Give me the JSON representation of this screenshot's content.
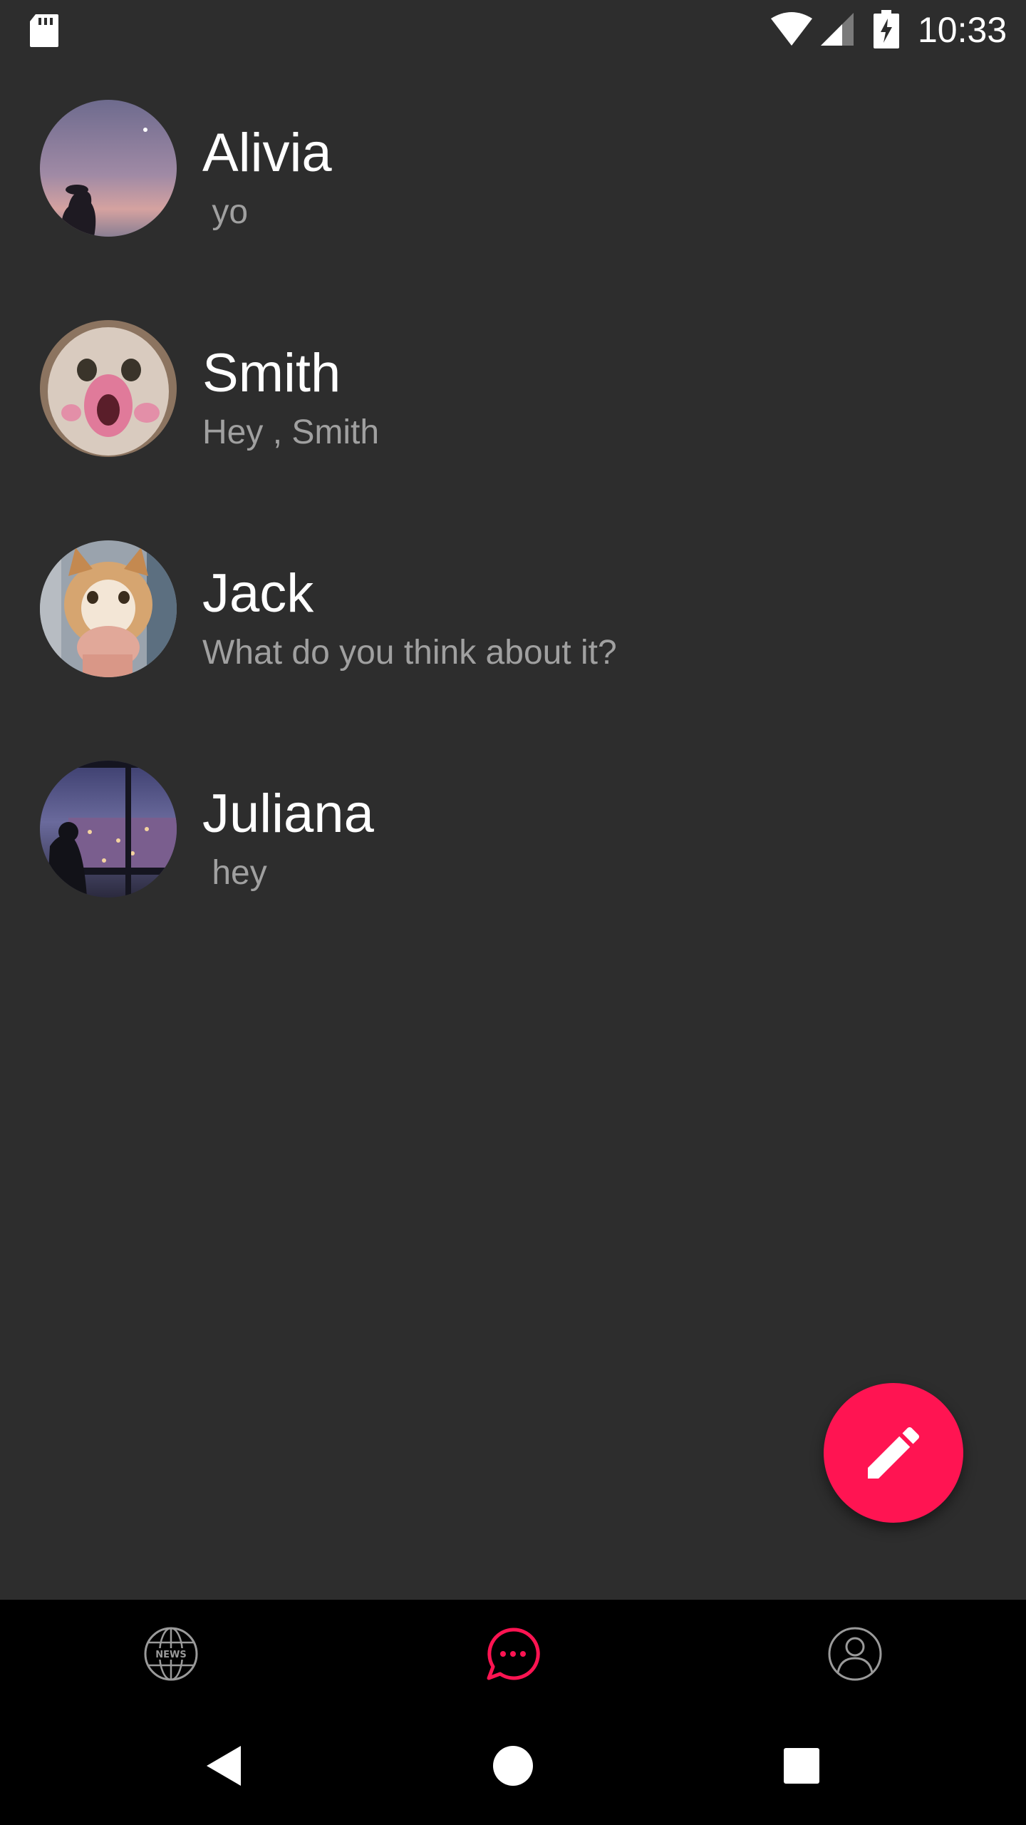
{
  "status_bar": {
    "time": "10:33",
    "icons": [
      "sd-card-icon",
      "wifi-icon",
      "cell-signal-icon",
      "battery-charging-icon"
    ]
  },
  "conversations": [
    {
      "name": "Alivia",
      "last_message": " yo",
      "avatar": "avatar-alivia"
    },
    {
      "name": "Smith",
      "last_message": "Hey , Smith",
      "avatar": "avatar-smith"
    },
    {
      "name": "Jack",
      "last_message": "What do you think about it?",
      "avatar": "avatar-jack"
    },
    {
      "name": "Juliana",
      "last_message": " hey",
      "avatar": "avatar-juliana"
    }
  ],
  "fab": {
    "icon": "pencil-icon"
  },
  "bottom_nav": {
    "tabs": [
      {
        "icon": "news-globe-icon",
        "label": "NEWS",
        "active": false
      },
      {
        "icon": "chat-bubble-icon",
        "active": true
      },
      {
        "icon": "profile-icon",
        "active": false
      }
    ]
  },
  "system_nav": {
    "buttons": [
      "back-icon",
      "home-icon",
      "recents-icon"
    ]
  },
  "colors": {
    "background": "#2d2d2d",
    "accent": "#ff1452",
    "primary_text": "#ffffff",
    "secondary_text": "#a0a0a0",
    "nav_background": "#000000"
  }
}
